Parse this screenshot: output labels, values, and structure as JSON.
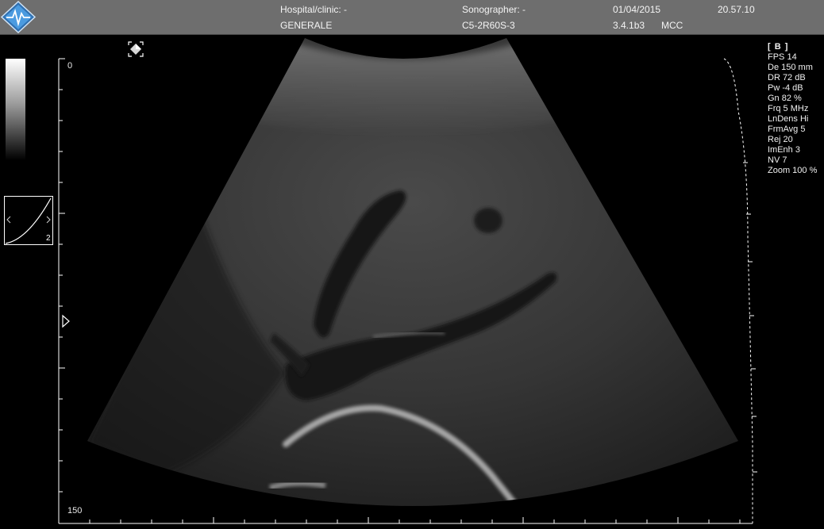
{
  "header": {
    "hospital_label": "Hospital/clinic: -",
    "hospital_value": "GENERALE",
    "sonographer_label": "Sonographer: -",
    "probe": "C5-2R60S-3",
    "date": "01/04/2015",
    "version": "3.4.1b3",
    "mode_tag": "MCC",
    "time": "20.57.10"
  },
  "depth_scale": {
    "start_label": "0",
    "end_label": "150"
  },
  "gain_curve": {
    "label": "2"
  },
  "imaging_params": {
    "mode": "[ B ]",
    "items": [
      "FPS 14",
      "De 150 mm",
      "DR 72 dB",
      "Pw -4 dB",
      "Gn 82 %",
      "Frq 5 MHz",
      "LnDens Hi",
      "FrmAvg 5",
      "Rej 20",
      "ImEnh 3",
      "NV 7",
      "Zoom 100 %"
    ]
  },
  "icons": {
    "logo": "esaote-diamond-logo",
    "freeze": "frame-select-icon",
    "focus_marker": "focus-marker-icon"
  },
  "colors": {
    "header_bg": "#6e6e6e",
    "logo_blue": "#3d8fd6",
    "text": "#f0f0f0"
  }
}
